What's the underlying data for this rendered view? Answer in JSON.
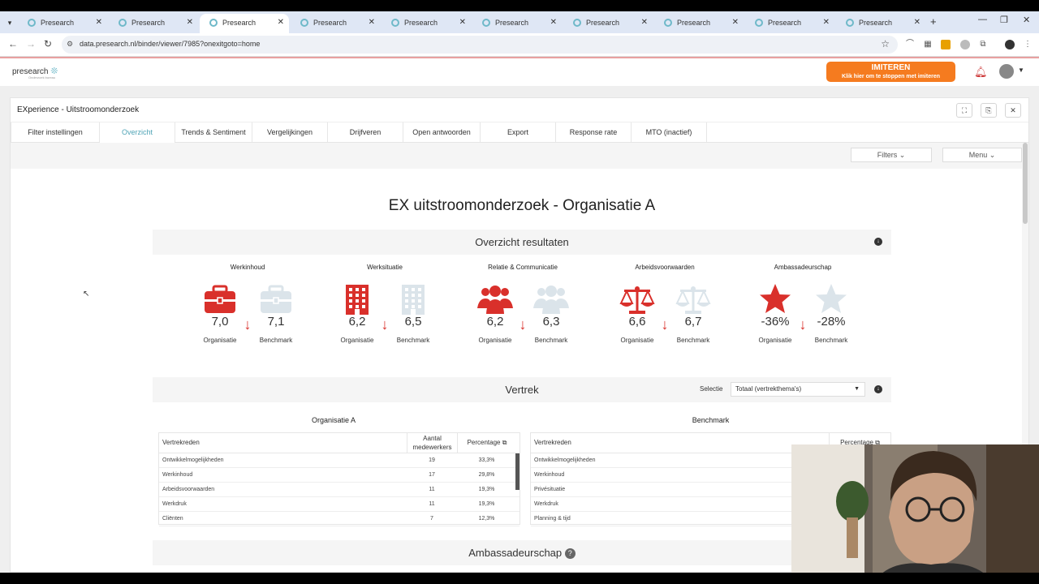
{
  "browser": {
    "tabs": [
      "Presearch",
      "Presearch",
      "Presearch",
      "Presearch",
      "Presearch",
      "Presearch",
      "Presearch",
      "Presearch",
      "Presearch",
      "Presearch"
    ],
    "active_tab": 2,
    "url": "data.presearch.nl/binder/viewer/7985?onexitgoto=home"
  },
  "header": {
    "logo": "presearch",
    "logo_sub": "Onderzoek bureau",
    "imitate_title": "IMITEREN",
    "imitate_sub": "Klik hier om te stoppen met imiteren"
  },
  "binder": {
    "title": "EXperience - Uitstroomonderzoek",
    "tabs": [
      "Filter instellingen",
      "Overzicht",
      "Trends & Sentiment",
      "Vergelijkingen",
      "Drijfveren",
      "Open antwoorden",
      "Export",
      "Response rate",
      "MTO (inactief)"
    ],
    "active_tab": 1,
    "filters_btn": "Filters",
    "menu_btn": "Menu"
  },
  "dashboard": {
    "title": "EX uitstroomonderzoek - Organisatie A",
    "overview_title": "Overzicht resultaten",
    "kpis": [
      {
        "name": "Werkinhoud",
        "icon": "briefcase-icon",
        "org": "7,0",
        "bench": "7,1"
      },
      {
        "name": "Werksituatie",
        "icon": "building-icon",
        "org": "6,2",
        "bench": "6,5"
      },
      {
        "name": "Relatie & Communicatie",
        "icon": "users-icon",
        "org": "6,2",
        "bench": "6,3"
      },
      {
        "name": "Arbeidsvoorwaarden",
        "icon": "scales-icon",
        "org": "6,6",
        "bench": "6,7"
      },
      {
        "name": "Ambassadeurschap",
        "icon": "star-icon",
        "org": "-36%",
        "bench": "-28%"
      }
    ],
    "org_label": "Organisatie",
    "bench_label": "Benchmark",
    "vertrek_title": "Vertrek",
    "selectie_label": "Selectie",
    "selectie_value": "Totaal (vertrekthema's)",
    "org_table": {
      "title": "Organisatie A",
      "headers": [
        "Vertrekreden",
        "Aantal medewerkers",
        "Percentage"
      ],
      "rows": [
        [
          "Ontwikkelmogelijkheden",
          "19",
          "33,3%"
        ],
        [
          "Werkinhoud",
          "17",
          "29,8%"
        ],
        [
          "Arbeidsvoorwaarden",
          "11",
          "19,3%"
        ],
        [
          "Werkdruk",
          "11",
          "19,3%"
        ],
        [
          "Cliënten",
          "7",
          "12,3%"
        ]
      ]
    },
    "bench_table": {
      "title": "Benchmark",
      "headers": [
        "Vertrekreden",
        "Percentage"
      ],
      "rows": [
        [
          "Ontwikkelmogelijkheden"
        ],
        [
          "Werkinhoud"
        ],
        [
          "Privésituatie"
        ],
        [
          "Werkdruk"
        ],
        [
          "Planning & tijd"
        ]
      ]
    },
    "ambassador_title": "Ambassadeurschap"
  },
  "colors": {
    "accent": "#4fa4b6",
    "orange": "#f57b1f",
    "red": "#d9302b",
    "ghost": "#dbe4ea"
  }
}
